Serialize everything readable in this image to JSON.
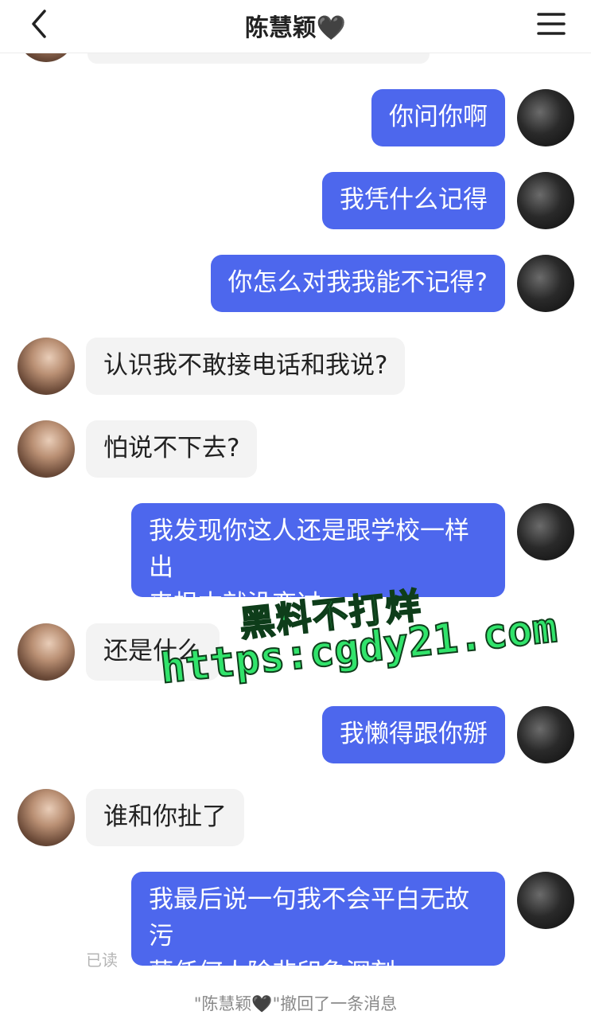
{
  "header": {
    "title": "陈慧颖",
    "title_emoji": "🖤",
    "back_icon": "chevron-left-icon",
    "menu_icon": "hamburger-menu-icon"
  },
  "messages": [
    {
      "side": "me",
      "text": "你问你啊"
    },
    {
      "side": "me",
      "text": "我凭什么记得"
    },
    {
      "side": "me",
      "text": "你怎么对我我能不记得?"
    },
    {
      "side": "them",
      "text": "认识我不敢接电话和我说?"
    },
    {
      "side": "them",
      "text": "怕说不下去?"
    },
    {
      "side": "me",
      "text_line1": "我发现你这人还是跟学校一样出",
      "text_line2": "来根本就没变过"
    },
    {
      "side": "them",
      "text": "还是什么"
    },
    {
      "side": "me",
      "text": "我懒得跟你掰"
    },
    {
      "side": "them",
      "text": "谁和你扯了"
    },
    {
      "side": "me",
      "text_line1": "我最后说一句我不会平白无故污",
      "text_line2": "蔑任何人除非印象深刻"
    }
  ],
  "read_status": "已读",
  "recall_notice": "\"陈慧颖🖤\"撤回了一条消息",
  "watermark": {
    "line1": "黑料不打烊",
    "line2": "https:cgdy21.com"
  },
  "colors": {
    "my_bubble": "#4d67ed",
    "their_bubble": "#f3f3f3",
    "watermark": "#31e36b"
  }
}
